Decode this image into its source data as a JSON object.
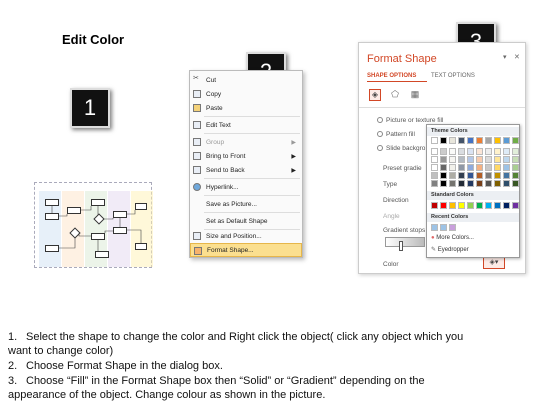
{
  "title": "Edit Color",
  "badges": [
    "1",
    "2",
    "3"
  ],
  "menu": {
    "items": [
      {
        "label": "Cut",
        "icon": "scissors-icon"
      },
      {
        "label": "Copy",
        "icon": "copy-icon"
      },
      {
        "label": "Paste",
        "icon": "paste-icon"
      },
      {
        "label": "Edit Text",
        "icon": "edit-text-icon"
      },
      {
        "label": "Group",
        "icon": "group-icon",
        "submenu": true
      },
      {
        "label": "Bring to Front",
        "icon": "bring-front-icon",
        "submenu": true
      },
      {
        "label": "Send to Back",
        "icon": "send-back-icon",
        "submenu": true
      },
      {
        "label": "Hyperlink...",
        "icon": "hyperlink-icon"
      },
      {
        "label": "Save as Picture...",
        "icon": ""
      },
      {
        "label": "Set as Default Shape",
        "icon": ""
      },
      {
        "label": "Size and Position...",
        "icon": "size-icon"
      },
      {
        "label": "Format Shape...",
        "icon": "format-shape-icon"
      }
    ],
    "highlighted": "Format Shape..."
  },
  "pane": {
    "title": "Format Shape",
    "tabs": [
      "SHAPE OPTIONS",
      "TEXT OPTIONS"
    ],
    "options": [
      "Picture or texture fill",
      "Pattern fill",
      "Slide background fill"
    ],
    "slide_bg_visible": "Slide backgro",
    "pattern_visible": "Pattern fill",
    "fields": [
      "Preset gradients",
      "Type",
      "Direction",
      "Angle",
      "Gradient stops",
      "Color"
    ],
    "preset_visible": "Preset gradie"
  },
  "palette": {
    "theme_header": "Theme Colors",
    "standard_header": "Standard Colors",
    "recent_header": "Recent Colors",
    "more_colors": "More Colors...",
    "eyedropper": "Eyedropper",
    "theme_top": [
      "#ffffff",
      "#000000",
      "#e8e6dc",
      "#44546a",
      "#4472c4",
      "#ed7d31",
      "#a5a5a5",
      "#ffc000",
      "#5b9bd5",
      "#70ad47"
    ],
    "standard": [
      "#c00000",
      "#ff0000",
      "#ffc000",
      "#ffff00",
      "#92d050",
      "#00b050",
      "#00b0f0",
      "#0070c0",
      "#002060",
      "#7030a0"
    ],
    "recent": [
      "#9dc3e6",
      "#9dc3e6",
      "#c9a0dc"
    ]
  },
  "instructions": [
    {
      "num": "1.",
      "text": "Select the shape to change the color and Right click the object( click any object which you",
      "cont": "want to change color)"
    },
    {
      "num": "2.",
      "text": "Choose Format Shape in the dialog box.",
      "cont": ""
    },
    {
      "num": "3.",
      "text": "Choose “Fill” in the Format Shape box then “Solid” or “Gradient” depending on the",
      "cont": "appearance of the object. Change colour as shown in the picture."
    }
  ]
}
